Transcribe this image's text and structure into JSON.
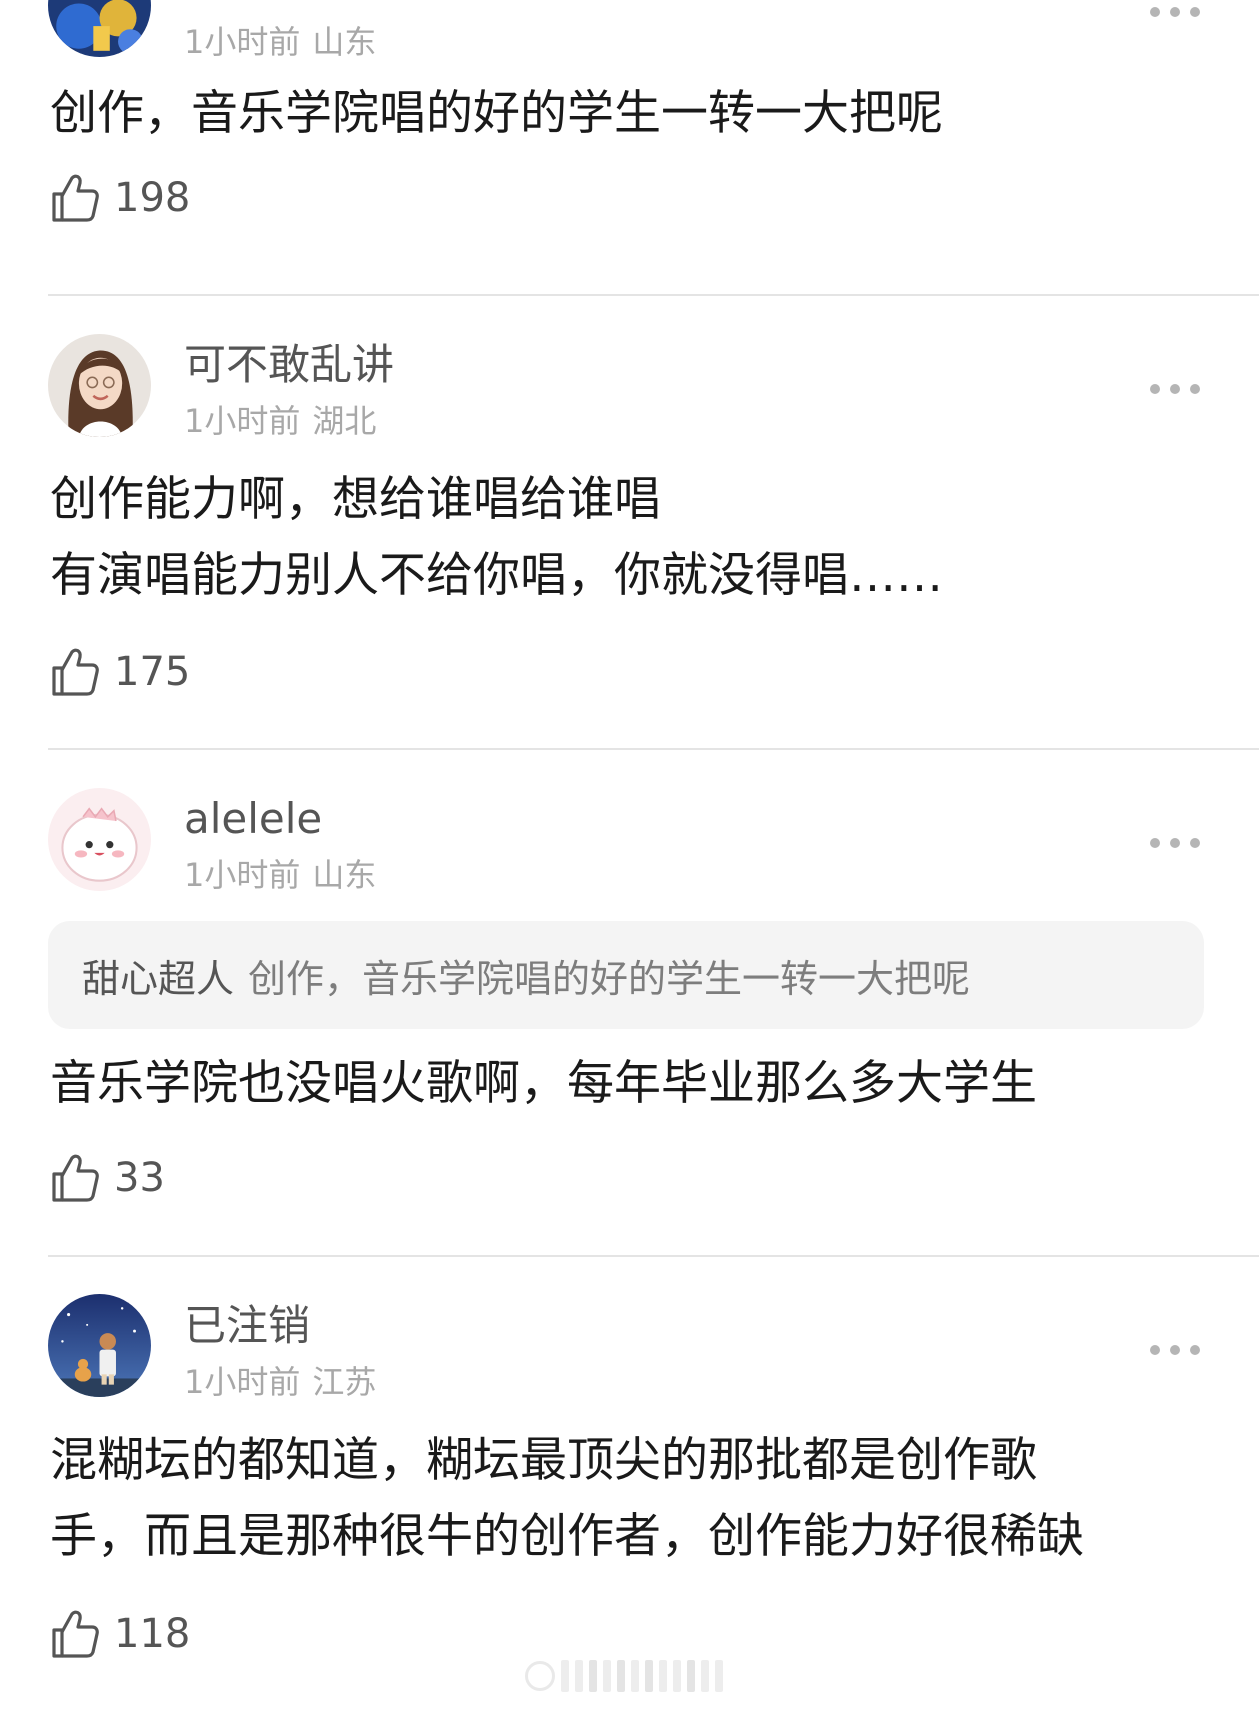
{
  "comments": [
    {
      "username": "",
      "time": "1小时前",
      "location": "山东",
      "lines": [
        "创作，音乐学院唱的好的学生一转一大把呢"
      ],
      "likes": "198",
      "avatar": "blue-yellow-photo"
    },
    {
      "username": "可不敢乱讲",
      "time": "1小时前",
      "location": "湖北",
      "lines": [
        "创作能力啊，想给谁唱给谁唱",
        "有演唱能力别人不给你唱，你就没得唱……"
      ],
      "likes": "175",
      "avatar": "woman-portrait"
    },
    {
      "username": "alelele",
      "time": "1小时前",
      "location": "山东",
      "quote": {
        "user": "甜心超人",
        "text": "创作，音乐学院唱的好的学生一转一大把呢"
      },
      "lines": [
        "音乐学院也没唱火歌啊，每年毕业那么多大学生"
      ],
      "likes": "33",
      "avatar": "cartoon-dinosaur"
    },
    {
      "username": "已注销",
      "time": "1小时前",
      "location": "江苏",
      "lines": [
        "混糊坛的都知道，糊坛最顶尖的那批都是创作歌",
        "手，而且是那种很牛的创作者，创作能力好很稀缺"
      ],
      "likes": "118",
      "avatar": "starry-sky-boy-cat"
    }
  ],
  "icons": {
    "like": "thumbs-up-icon",
    "more": "more-dots-icon"
  },
  "colors": {
    "username": "#555555",
    "meta": "#a8a8a8",
    "body": "#1a1a1a",
    "divider": "#e4e4e4",
    "quote_bg": "#f4f4f4"
  }
}
